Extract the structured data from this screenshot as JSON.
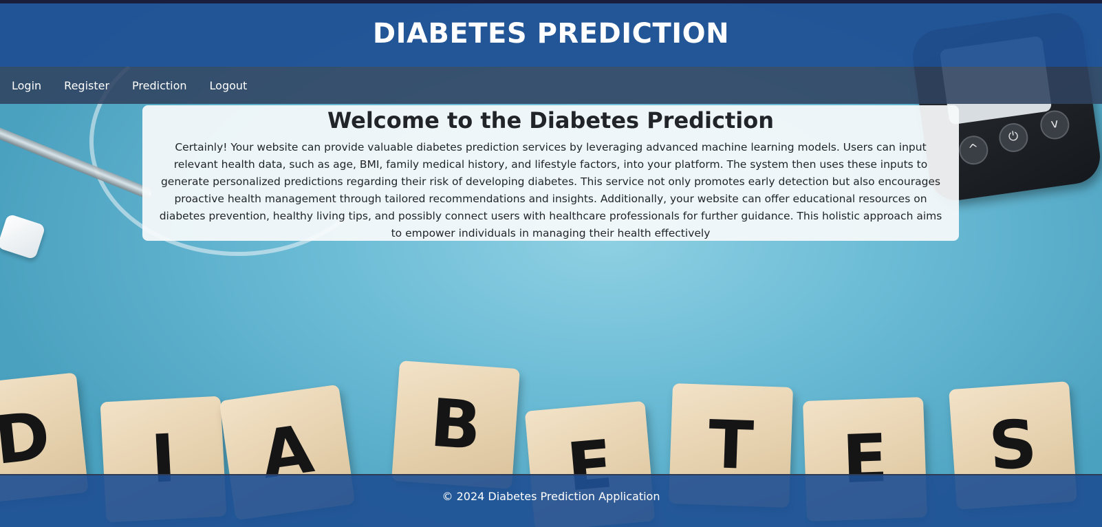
{
  "header": {
    "title": "DIABETES PREDICTION"
  },
  "nav": {
    "items": [
      {
        "label": "Login"
      },
      {
        "label": "Register"
      },
      {
        "label": "Prediction"
      },
      {
        "label": "Logout"
      }
    ]
  },
  "welcome": {
    "heading": "Welcome to the Diabetes Prediction",
    "body": "Certainly! Your website can provide valuable diabetes prediction services by leveraging advanced machine learning models. Users can input relevant health data, such as age, BMI, family medical history, and lifestyle factors, into your platform. The system then uses these inputs to generate personalized predictions regarding their risk of developing diabetes. This service not only promotes early detection but also encourages proactive health management through tailored recommendations and insights. Additionally, your website can offer educational resources on diabetes prevention, healthy living tips, and possibly connect users with healthcare professionals for further guidance. This holistic approach aims to empower individuals in managing their health effectively"
  },
  "background": {
    "tiles": [
      "D",
      "I",
      "A",
      "B",
      "E",
      "T",
      "E",
      "S"
    ]
  },
  "footer": {
    "text": "© 2024 Diabetes Prediction Application"
  },
  "colors": {
    "header_bg": "#1e4f92",
    "nav_bg": "#304260",
    "card_bg": "#f8fafb",
    "footer_bg": "#1e4f92",
    "background_blue": "#5aaecb"
  }
}
